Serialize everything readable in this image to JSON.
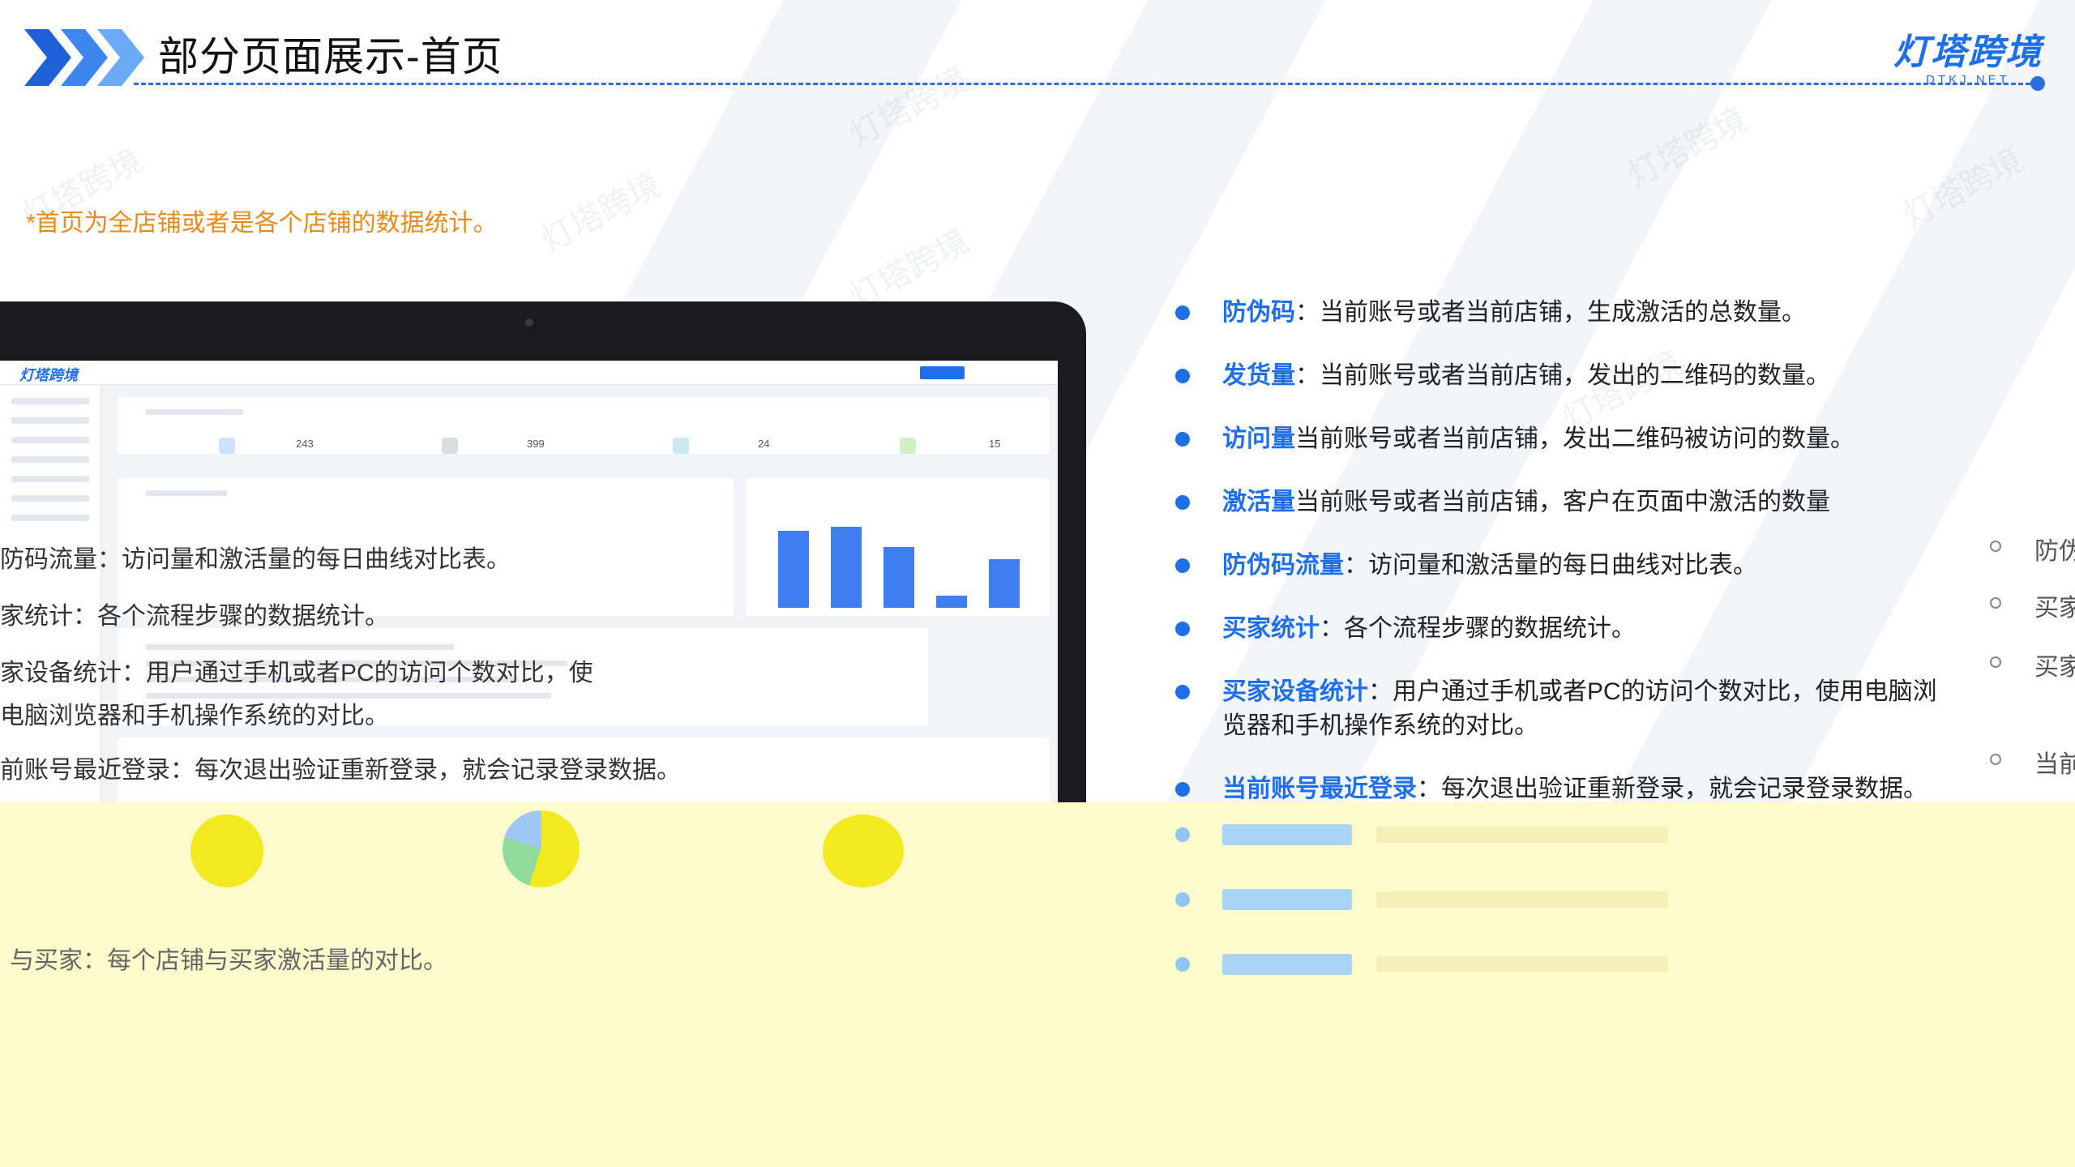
{
  "header": {
    "title": "部分页面展示-首页",
    "brand_name": "灯塔跨境",
    "brand_domain": "DTKJ.NET"
  },
  "watermark_text": "灯塔跨境",
  "note": "*首页为全店铺或者是各个店铺的数据统计。",
  "app_screen": {
    "logo": "灯塔跨境",
    "stats": [
      "243",
      "399",
      "24",
      "15"
    ]
  },
  "left_descriptions": [
    "防码流量：访问量和激活量的每日曲线对比表。",
    "家统计：各个流程步骤的数据统计。",
    "家设备统计：用户通过手机或者PC的访问个数对比，使",
    "电脑浏览器和手机操作系统的对比。",
    "前账号最近登录：每次退出验证重新登录，就会记录登录数据。",
    "与买家：每个店铺与买家激活量的对比。"
  ],
  "right_list": [
    {
      "key": "防伪码",
      "text": "：当前账号或者当前店铺，生成激活的总数量。"
    },
    {
      "key": "发货量",
      "text": "：当前账号或者当前店铺，发出的二维码的数量。"
    },
    {
      "key": "访问量",
      "text": "当前账号或者当前店铺，发出二维码被访问的数量。"
    },
    {
      "key": "激活量",
      "text": "当前账号或者当前店铺，客户在页面中激活的数量"
    },
    {
      "key": "防伪码流量",
      "text": "：访问量和激活量的每日曲线对比表。"
    },
    {
      "key": "买家统计",
      "text": "：各个流程步骤的数据统计。"
    },
    {
      "key": "买家设备统计",
      "text": "：用户通过手机或者PC的访问个数对比，使用电脑浏览器和手机操作系统的对比。"
    },
    {
      "key": "当前账号最近登录",
      "text": "：每次退出验证重新登录，就会记录登录数据。"
    }
  ],
  "right_column": [
    "防伪",
    "买家",
    "买家",
    "当前"
  ],
  "colors": {
    "accent": "#1f6fe8",
    "note": "#e98a19",
    "band": "#fdfbcc"
  }
}
